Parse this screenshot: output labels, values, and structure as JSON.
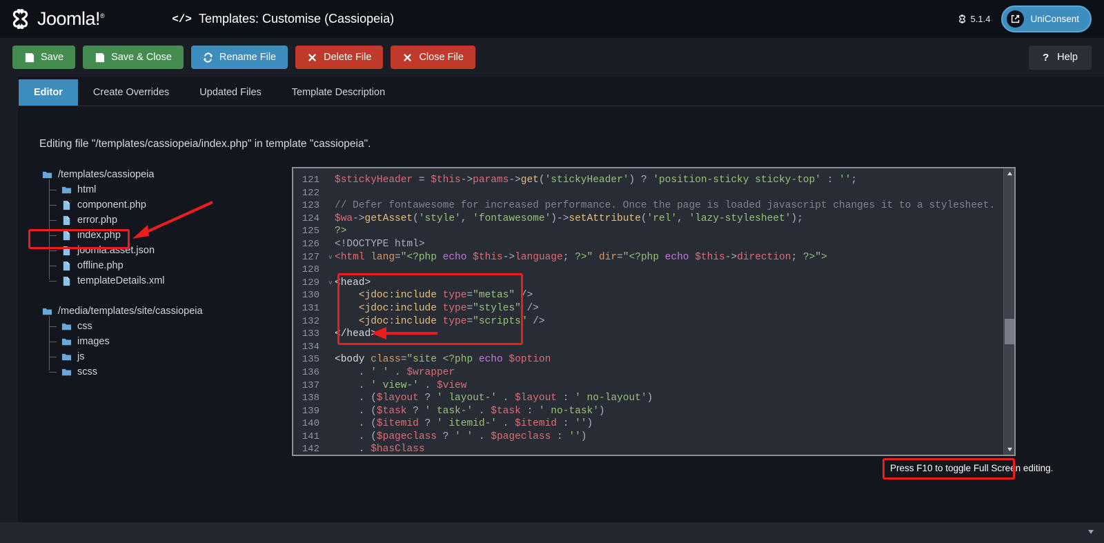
{
  "header": {
    "brand": "Joomla!",
    "brand_mark": "®",
    "code_icon": "</>",
    "title": "Templates: Customise (Cassiopeia)",
    "version": "5.1.4",
    "version_icon": "joomla-glyph-icon",
    "uniconsent_label": "UniConsent",
    "uniconsent_icon": "external-link-icon"
  },
  "toolbar": {
    "buttons": [
      {
        "label": "Save",
        "icon": "floppy-disk-icon",
        "style": "green"
      },
      {
        "label": "Save & Close",
        "icon": "floppy-disk-icon",
        "style": "green"
      },
      {
        "label": "Rename File",
        "icon": "refresh-icon",
        "style": "blue"
      },
      {
        "label": "Delete File",
        "icon": "x-icon",
        "style": "red"
      },
      {
        "label": "Close File",
        "icon": "x-icon",
        "style": "red"
      }
    ],
    "help_label": "Help",
    "help_icon": "question-mark-icon"
  },
  "tabs": [
    {
      "label": "Editor",
      "active": true
    },
    {
      "label": "Create Overrides",
      "active": false
    },
    {
      "label": "Updated Files",
      "active": false
    },
    {
      "label": "Template Description",
      "active": false
    }
  ],
  "editing_note": "Editing file \"/templates/cassiopeia/index.php\" in template \"cassiopeia\".",
  "filetree": [
    {
      "root": "/templates/cassiopeia",
      "icon": "folder-icon",
      "children": [
        {
          "label": "html",
          "icon": "folder-icon",
          "selected": false
        },
        {
          "label": "component.php",
          "icon": "file-icon",
          "selected": false
        },
        {
          "label": "error.php",
          "icon": "file-icon",
          "selected": false
        },
        {
          "label": "index.php",
          "icon": "file-icon",
          "selected": true
        },
        {
          "label": "joomla.asset.json",
          "icon": "file-icon",
          "selected": false
        },
        {
          "label": "offline.php",
          "icon": "file-icon",
          "selected": false
        },
        {
          "label": "templateDetails.xml",
          "icon": "file-icon",
          "selected": false
        }
      ]
    },
    {
      "root": "/media/templates/site/cassiopeia",
      "icon": "folder-icon",
      "children": [
        {
          "label": "css",
          "icon": "folder-icon",
          "selected": false
        },
        {
          "label": "images",
          "icon": "folder-icon",
          "selected": false
        },
        {
          "label": "js",
          "icon": "folder-icon",
          "selected": false
        },
        {
          "label": "scss",
          "icon": "folder-icon",
          "selected": false
        }
      ]
    }
  ],
  "editor": {
    "first_line_number": 121,
    "lines": [
      {
        "n": 121,
        "fold": "",
        "tokens": [
          {
            "t": "$stickyHeader",
            "c": "t-var"
          },
          {
            "t": " = ",
            "c": "t-op"
          },
          {
            "t": "$this",
            "c": "t-var"
          },
          {
            "t": "->",
            "c": "t-op"
          },
          {
            "t": "params",
            "c": "t-var"
          },
          {
            "t": "->",
            "c": "t-op"
          },
          {
            "t": "get",
            "c": "t-fn"
          },
          {
            "t": "(",
            "c": "t-punc"
          },
          {
            "t": "'stickyHeader'",
            "c": "t-str"
          },
          {
            "t": ") ",
            "c": "t-punc"
          },
          {
            "t": "? ",
            "c": "t-op"
          },
          {
            "t": "'position-sticky sticky-top'",
            "c": "t-str"
          },
          {
            "t": " : ",
            "c": "t-op"
          },
          {
            "t": "''",
            "c": "t-str"
          },
          {
            "t": ";",
            "c": "t-punc"
          }
        ]
      },
      {
        "n": 122,
        "fold": "",
        "tokens": []
      },
      {
        "n": 123,
        "fold": "",
        "tokens": [
          {
            "t": "// Defer fontawesome for increased performance. Once the page is loaded javascript changes it to a stylesheet.",
            "c": "t-com"
          }
        ]
      },
      {
        "n": 124,
        "fold": "",
        "tokens": [
          {
            "t": "$wa",
            "c": "t-var"
          },
          {
            "t": "->",
            "c": "t-op"
          },
          {
            "t": "getAsset",
            "c": "t-fn"
          },
          {
            "t": "(",
            "c": "t-punc"
          },
          {
            "t": "'style'",
            "c": "t-str"
          },
          {
            "t": ", ",
            "c": "t-punc"
          },
          {
            "t": "'fontawesome'",
            "c": "t-str"
          },
          {
            "t": ")",
            "c": "t-punc"
          },
          {
            "t": "->",
            "c": "t-op"
          },
          {
            "t": "setAttribute",
            "c": "t-fn"
          },
          {
            "t": "(",
            "c": "t-punc"
          },
          {
            "t": "'rel'",
            "c": "t-str"
          },
          {
            "t": ", ",
            "c": "t-punc"
          },
          {
            "t": "'lazy-stylesheet'",
            "c": "t-str"
          },
          {
            "t": ");",
            "c": "t-punc"
          }
        ]
      },
      {
        "n": 125,
        "fold": "",
        "tokens": [
          {
            "t": "?>",
            "c": "t-green"
          }
        ]
      },
      {
        "n": 126,
        "fold": "",
        "tokens": [
          {
            "t": "<!DOCTYPE html>",
            "c": "t-plain"
          }
        ]
      },
      {
        "n": 127,
        "fold": "v",
        "tokens": [
          {
            "t": "<html",
            "c": "t-tag"
          },
          {
            "t": " lang",
            "c": "t-attr"
          },
          {
            "t": "=",
            "c": "t-punc"
          },
          {
            "t": "\"",
            "c": "t-green"
          },
          {
            "t": "<?php",
            "c": "t-green"
          },
          {
            "t": " echo ",
            "c": "t-kw"
          },
          {
            "t": "$this",
            "c": "t-var"
          },
          {
            "t": "->",
            "c": "t-op"
          },
          {
            "t": "language",
            "c": "t-var"
          },
          {
            "t": "; ",
            "c": "t-punc"
          },
          {
            "t": "?>",
            "c": "t-green"
          },
          {
            "t": "\"",
            "c": "t-green"
          },
          {
            "t": " dir",
            "c": "t-attr"
          },
          {
            "t": "=",
            "c": "t-punc"
          },
          {
            "t": "\"",
            "c": "t-green"
          },
          {
            "t": "<?php",
            "c": "t-green"
          },
          {
            "t": " echo ",
            "c": "t-kw"
          },
          {
            "t": "$this",
            "c": "t-var"
          },
          {
            "t": "->",
            "c": "t-op"
          },
          {
            "t": "direction",
            "c": "t-var"
          },
          {
            "t": "; ",
            "c": "t-punc"
          },
          {
            "t": "?>",
            "c": "t-green"
          },
          {
            "t": "\">",
            "c": "t-green"
          }
        ]
      },
      {
        "n": 128,
        "fold": "",
        "tokens": []
      },
      {
        "n": 129,
        "fold": "v",
        "tokens": [
          {
            "t": "<head>",
            "c": "t-white"
          }
        ]
      },
      {
        "n": 130,
        "fold": "",
        "tokens": [
          {
            "t": "    ",
            "c": "t-plain"
          },
          {
            "t": "<jdoc:include",
            "c": "t-fn"
          },
          {
            "t": " type",
            "c": "t-var"
          },
          {
            "t": "=",
            "c": "t-punc"
          },
          {
            "t": "\"metas\"",
            "c": "t-green"
          },
          {
            "t": " />",
            "c": "t-plain"
          }
        ]
      },
      {
        "n": 131,
        "fold": "",
        "tokens": [
          {
            "t": "    ",
            "c": "t-plain"
          },
          {
            "t": "<jdoc:include",
            "c": "t-fn"
          },
          {
            "t": " type",
            "c": "t-var"
          },
          {
            "t": "=",
            "c": "t-punc"
          },
          {
            "t": "\"styles\"",
            "c": "t-green"
          },
          {
            "t": " />",
            "c": "t-plain"
          }
        ]
      },
      {
        "n": 132,
        "fold": "",
        "tokens": [
          {
            "t": "    ",
            "c": "t-plain"
          },
          {
            "t": "<jdoc:include",
            "c": "t-fn"
          },
          {
            "t": " type",
            "c": "t-var"
          },
          {
            "t": "=",
            "c": "t-punc"
          },
          {
            "t": "\"scripts\"",
            "c": "t-green"
          },
          {
            "t": " />",
            "c": "t-plain"
          }
        ]
      },
      {
        "n": 133,
        "fold": "",
        "tokens": [
          {
            "t": "</head>",
            "c": "t-white"
          }
        ]
      },
      {
        "n": 134,
        "fold": "",
        "tokens": []
      },
      {
        "n": 135,
        "fold": "",
        "tokens": [
          {
            "t": "<body",
            "c": "t-white"
          },
          {
            "t": " class",
            "c": "t-attr"
          },
          {
            "t": "=",
            "c": "t-punc"
          },
          {
            "t": "\"site ",
            "c": "t-green"
          },
          {
            "t": "<?php",
            "c": "t-green"
          },
          {
            "t": " echo ",
            "c": "t-kw"
          },
          {
            "t": "$option",
            "c": "t-var"
          }
        ]
      },
      {
        "n": 136,
        "fold": "",
        "tokens": [
          {
            "t": "    . ",
            "c": "t-op"
          },
          {
            "t": "' '",
            "c": "t-str"
          },
          {
            "t": " . ",
            "c": "t-op"
          },
          {
            "t": "$wrapper",
            "c": "t-var"
          }
        ]
      },
      {
        "n": 137,
        "fold": "",
        "tokens": [
          {
            "t": "    . ",
            "c": "t-op"
          },
          {
            "t": "' view-'",
            "c": "t-str"
          },
          {
            "t": " . ",
            "c": "t-op"
          },
          {
            "t": "$view",
            "c": "t-var"
          }
        ]
      },
      {
        "n": 138,
        "fold": "",
        "tokens": [
          {
            "t": "    . ",
            "c": "t-op"
          },
          {
            "t": "(",
            "c": "t-punc"
          },
          {
            "t": "$layout",
            "c": "t-var"
          },
          {
            "t": " ? ",
            "c": "t-op"
          },
          {
            "t": "' layout-'",
            "c": "t-str"
          },
          {
            "t": " . ",
            "c": "t-op"
          },
          {
            "t": "$layout",
            "c": "t-var"
          },
          {
            "t": " : ",
            "c": "t-op"
          },
          {
            "t": "' no-layout'",
            "c": "t-str"
          },
          {
            "t": ")",
            "c": "t-punc"
          }
        ]
      },
      {
        "n": 139,
        "fold": "",
        "tokens": [
          {
            "t": "    . ",
            "c": "t-op"
          },
          {
            "t": "(",
            "c": "t-punc"
          },
          {
            "t": "$task",
            "c": "t-var"
          },
          {
            "t": " ? ",
            "c": "t-op"
          },
          {
            "t": "' task-'",
            "c": "t-str"
          },
          {
            "t": " . ",
            "c": "t-op"
          },
          {
            "t": "$task",
            "c": "t-var"
          },
          {
            "t": " : ",
            "c": "t-op"
          },
          {
            "t": "' no-task'",
            "c": "t-str"
          },
          {
            "t": ")",
            "c": "t-punc"
          }
        ]
      },
      {
        "n": 140,
        "fold": "",
        "tokens": [
          {
            "t": "    . ",
            "c": "t-op"
          },
          {
            "t": "(",
            "c": "t-punc"
          },
          {
            "t": "$itemid",
            "c": "t-var"
          },
          {
            "t": " ? ",
            "c": "t-op"
          },
          {
            "t": "' itemid-'",
            "c": "t-str"
          },
          {
            "t": " . ",
            "c": "t-op"
          },
          {
            "t": "$itemid",
            "c": "t-var"
          },
          {
            "t": " : ",
            "c": "t-op"
          },
          {
            "t": "''",
            "c": "t-str"
          },
          {
            "t": ")",
            "c": "t-punc"
          }
        ]
      },
      {
        "n": 141,
        "fold": "",
        "tokens": [
          {
            "t": "    . ",
            "c": "t-op"
          },
          {
            "t": "(",
            "c": "t-punc"
          },
          {
            "t": "$pageclass",
            "c": "t-var"
          },
          {
            "t": " ? ",
            "c": "t-op"
          },
          {
            "t": "' '",
            "c": "t-str"
          },
          {
            "t": " . ",
            "c": "t-op"
          },
          {
            "t": "$pageclass",
            "c": "t-var"
          },
          {
            "t": " : ",
            "c": "t-op"
          },
          {
            "t": "''",
            "c": "t-str"
          },
          {
            "t": ")",
            "c": "t-punc"
          }
        ]
      },
      {
        "n": 142,
        "fold": "",
        "tokens": [
          {
            "t": "    . ",
            "c": "t-op"
          },
          {
            "t": "$hasClass",
            "c": "t-var"
          }
        ]
      }
    ],
    "scrollbar": {
      "up_icon": "caret-up-icon",
      "down_icon": "caret-down-icon"
    }
  },
  "footer_note": "Press F10 to toggle Full Screen editing.",
  "annotations": {
    "color": "#ee1d1d",
    "boxes": [
      "index-php-file",
      "head-block",
      "fullscreen-note"
    ],
    "arrows": [
      "arrow-to-index-php",
      "arrow-to-head-close-tag"
    ]
  },
  "colors": {
    "accent_blue": "#3d8dbf",
    "green": "#458c51",
    "red": "#c0392b",
    "annotation_red": "#ee1d1d",
    "page_bg": "#1a1d23",
    "header_bg": "#0d1117",
    "editor_bg": "#282c34"
  }
}
